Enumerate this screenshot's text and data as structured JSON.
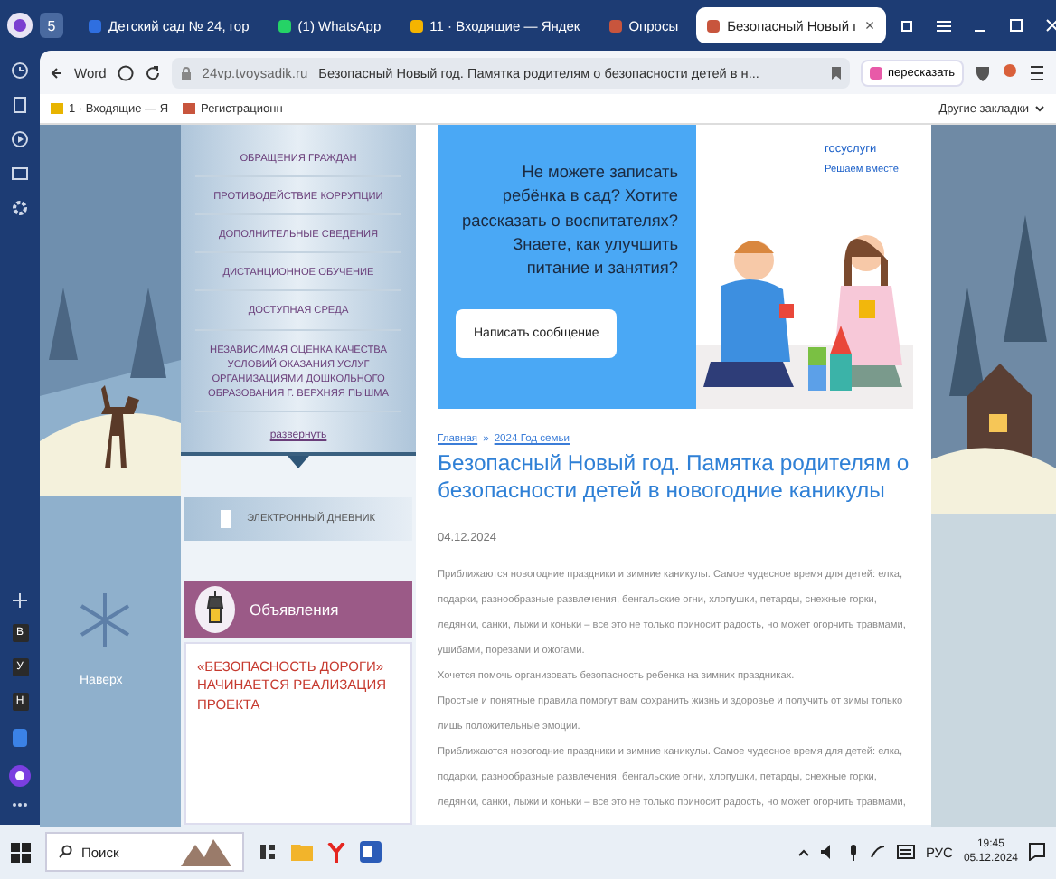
{
  "browser": {
    "workspace_count": "5",
    "tabs": [
      {
        "label": "Детский сад № 24, гор",
        "selected": false,
        "color": "#2f6fe0"
      },
      {
        "label": "(1) WhatsApp",
        "selected": false,
        "color": "#25d366"
      },
      {
        "label": "11 · Входящие — Яндек",
        "selected": false,
        "color": "#f5b400"
      },
      {
        "label": "Опросы",
        "selected": false,
        "color": "#c8553d"
      },
      {
        "label": "Безопасный Новый г",
        "selected": true,
        "color": "#c8553d"
      }
    ],
    "close_tab": "×"
  },
  "toolbar": {
    "back_label": "Word",
    "domain": "24vp.tvoysadik.ru",
    "page_title": "Безопасный Новый год. Памятка родителям о безопасности детей в н...",
    "summarize": "пересказать"
  },
  "bookmarks": {
    "items": [
      "1 · Входящие — Я",
      "Регистрационн"
    ],
    "other": "Другие закладки"
  },
  "side_panel": {
    "apps": [
      "В",
      "У",
      "Н"
    ]
  },
  "site": {
    "nav": {
      "items": [
        "ОБРАЩЕНИЯ ГРАЖДАН",
        "ПРОТИВОДЕЙСТВИЕ КОРРУПЦИИ",
        "ДОПОЛНИТЕЛЬНЫЕ СВЕДЕНИЯ",
        "ДИСТАНЦИОННОЕ ОБУЧЕНИЕ",
        "ДОСТУПНАЯ СРЕДА",
        "НЕЗАВИСИМАЯ ОЦЕНКА КАЧЕСТВА УСЛОВИЙ ОКАЗАНИЯ УСЛУГ ОРГАНИЗАЦИЯМИ ДОШКОЛЬНОГО ОБРАЗОВАНИЯ Г. ВЕРХНЯЯ ПЫШМА"
      ],
      "expand": "развернуть"
    },
    "diary": "ЭЛЕКТРОННЫЙ ДНЕВНИК",
    "announcements": {
      "title": "Объявления",
      "items": [
        "«БЕЗОПАСНОСТЬ ДОРОГИ» НАЧИНАЕТСЯ РЕАЛИЗАЦИЯ ПРОЕКТА"
      ]
    },
    "to_top": "Наверх",
    "banner": {
      "text": "Не можете записать ребёнка в сад? Хотите рассказать о воспитателях? Знаете, как улучшить питание и занятия?",
      "button": "Написать сообщение",
      "brand": "госуслуги",
      "slogan": "Решаем вместе"
    },
    "article": {
      "breadcrumbs": [
        "Главная",
        "2024 Год семьи"
      ],
      "separator": "»",
      "title": "Безопасный Новый год. Памятка родителям о безопасности детей в новогодние каникулы",
      "date": "04.12.2024",
      "paragraphs": [
        "Приближаются новогодние праздники и зимние каникулы. Самое чудесное время для детей: елка, подарки, разнообразные развлечения, бенгальские огни, хлопушки, петарды, снежные горки, ледянки, санки, лыжи и коньки – все это не только приносит радость, но может огорчить травмами, ушибами, порезами и ожогами.",
        "Хочется помочь организовать безопасность ребенка на зимних праздниках.",
        "Простые и понятные правила помогут вам сохранить жизнь и здоровье и получить от зимы только лишь положительные эмоции.",
        "Приближаются новогодние праздники и зимние каникулы. Самое чудесное время для детей: елка, подарки, разнообразные развлечения, бенгальские огни, хлопушки, петарды, снежные горки, ледянки, санки, лыжи и коньки – все это не только приносит радость, но может огорчить травмами,"
      ]
    }
  },
  "taskbar": {
    "search": "Поиск",
    "language": "РУС",
    "time": "19:45",
    "date": "05.12.2024"
  }
}
